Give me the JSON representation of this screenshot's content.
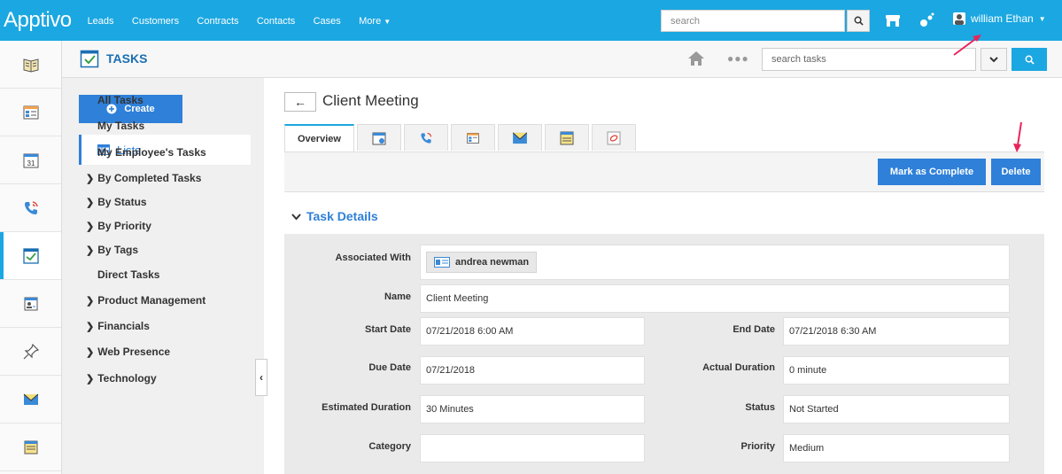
{
  "brand": {
    "logo": "Apptivo"
  },
  "topnav": {
    "items": [
      "Leads",
      "Customers",
      "Contracts",
      "Contacts",
      "Cases"
    ],
    "more_label": "More"
  },
  "top_search": {
    "placeholder": "search"
  },
  "user": {
    "name": "william Ethan"
  },
  "app": {
    "title": "TASKS"
  },
  "task_search": {
    "placeholder": "search tasks"
  },
  "sidebar": {
    "create_label": "Create",
    "lists_label": "Lists",
    "items": [
      {
        "label": "All Tasks",
        "chevron": false
      },
      {
        "label": "My Tasks",
        "chevron": false
      },
      {
        "label": "My Employee's Tasks",
        "chevron": false
      },
      {
        "label": "By Completed Tasks",
        "chevron": true
      },
      {
        "label": "By Status",
        "chevron": true
      },
      {
        "label": "By Priority",
        "chevron": true
      },
      {
        "label": "By Tags",
        "chevron": true
      },
      {
        "label": "Direct Tasks",
        "chevron": false
      },
      {
        "label": "Product Management",
        "chevron": true
      },
      {
        "label": "Financials",
        "chevron": true
      },
      {
        "label": "Web Presence",
        "chevron": true
      },
      {
        "label": "Technology",
        "chevron": true
      }
    ]
  },
  "record": {
    "title": "Client Meeting"
  },
  "tabs": {
    "overview_label": "Overview",
    "icon_tabs": [
      "calendar-icon",
      "phone-icon",
      "note-list-icon",
      "envelope-icon",
      "sticky-note-icon",
      "attachment-icon"
    ]
  },
  "actions": {
    "mark_complete_label": "Mark as Complete",
    "delete_label": "Delete"
  },
  "section": {
    "title": "Task Details"
  },
  "fields": {
    "associated_with": {
      "label": "Associated With",
      "value": "andrea newman"
    },
    "name": {
      "label": "Name",
      "value": "Client Meeting"
    },
    "start_date": {
      "label": "Start Date",
      "value": "07/21/2018 6:00 AM"
    },
    "end_date": {
      "label": "End Date",
      "value": "07/21/2018 6:30 AM"
    },
    "due_date": {
      "label": "Due Date",
      "value": "07/21/2018"
    },
    "actual_duration": {
      "label": "Actual Duration",
      "value": "0 minute"
    },
    "estimated_duration": {
      "label": "Estimated Duration",
      "value": "30 Minutes"
    },
    "status": {
      "label": "Status",
      "value": "Not Started"
    },
    "category": {
      "label": "Category",
      "value": ""
    },
    "priority": {
      "label": "Priority",
      "value": "Medium"
    }
  },
  "colors": {
    "topbar": "#1ba7e1",
    "primary_button": "#2f80d9",
    "annotation_arrow": "#e8245a"
  }
}
